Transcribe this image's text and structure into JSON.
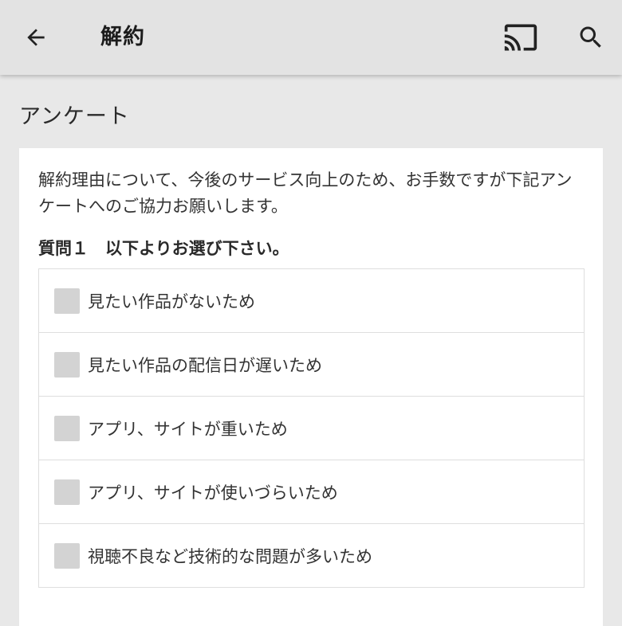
{
  "header": {
    "title": "解約",
    "back_icon": "arrow-left-icon",
    "cast_icon": "cast-icon",
    "search_icon": "search-icon"
  },
  "section": {
    "title": "アンケート"
  },
  "survey": {
    "intro": "解約理由について、今後のサービス向上のため、お手数ですが下記アンケートへのご協力お願いします。",
    "question": "質問１　以下よりお選び下さい。",
    "options": [
      {
        "label": "見たい作品がないため",
        "checked": false
      },
      {
        "label": "見たい作品の配信日が遅いため",
        "checked": false
      },
      {
        "label": "アプリ、サイトが重いため",
        "checked": false
      },
      {
        "label": "アプリ、サイトが使いづらいため",
        "checked": false
      },
      {
        "label": "視聴不良など技術的な問題が多いため",
        "checked": false
      }
    ]
  },
  "colors": {
    "appbar_bg": "#e3e3e3",
    "page_bg": "#e8e8e8",
    "card_bg": "#ffffff",
    "checkbox": "#d3d3d3",
    "icon": "#222222"
  }
}
